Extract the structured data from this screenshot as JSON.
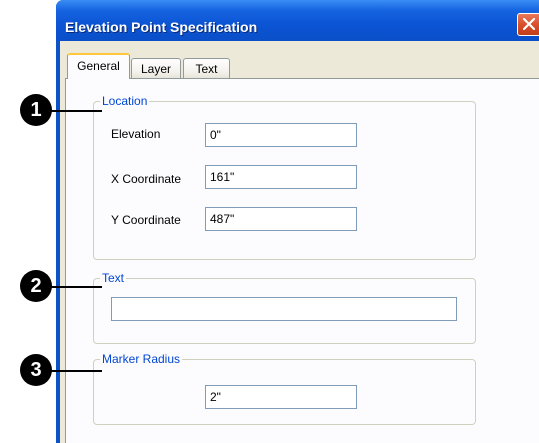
{
  "window": {
    "title": "Elevation Point Specification"
  },
  "tabs": [
    {
      "label": "General",
      "active": true
    },
    {
      "label": "Layer",
      "active": false
    },
    {
      "label": "Text",
      "active": false
    }
  ],
  "location": {
    "legend": "Location",
    "elevation": {
      "label": "Elevation",
      "value": "0\""
    },
    "x_coordinate": {
      "label": "X Coordinate",
      "value": "161\""
    },
    "y_coordinate": {
      "label": "Y Coordinate",
      "value": "487\""
    }
  },
  "text_group": {
    "legend": "Text",
    "value": ""
  },
  "marker_radius": {
    "legend": "Marker Radius",
    "value": "2\""
  },
  "callouts": [
    "1",
    "2",
    "3"
  ],
  "colors": {
    "titlebar": "#0b54d4",
    "group_legend": "#0046d5",
    "close_button": "#d9502b"
  }
}
